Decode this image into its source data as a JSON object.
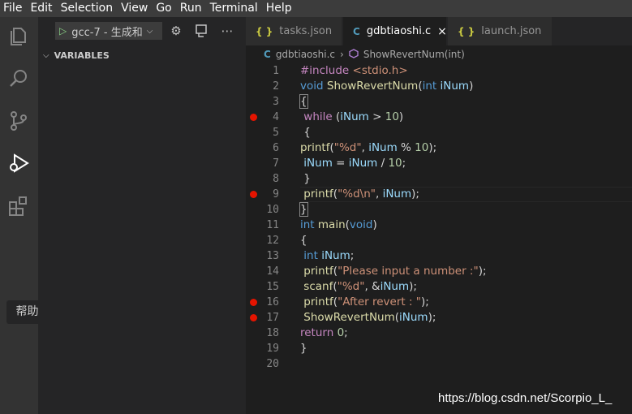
{
  "menu": [
    "File",
    "Edit",
    "Selection",
    "View",
    "Go",
    "Run",
    "Terminal",
    "Help"
  ],
  "activity_bar": {
    "icons": [
      "explorer-icon",
      "search-icon",
      "source-control-icon",
      "run-debug-icon",
      "extensions-icon"
    ],
    "tooltip": "帮助"
  },
  "debug": {
    "config": "gcc-7 - 生成和",
    "toolbar_icons": [
      "gear-icon",
      "debug-console-icon",
      "more-icon"
    ]
  },
  "sidebar": {
    "section_title": "VARIABLES"
  },
  "tabs": [
    {
      "icon": "{ }",
      "label": "tasks.json",
      "active": false
    },
    {
      "icon": "C",
      "label": "gdbtiaoshi.c",
      "active": true
    },
    {
      "icon": "{ }",
      "label": "launch.json",
      "active": false
    }
  ],
  "tab_close_glyph": "×",
  "breadcrumb": {
    "file_icon": "C",
    "file": "gdbtiaoshi.c",
    "separator": "›",
    "symbol": "ShowRevertNum(int)"
  },
  "code_lines": [
    {
      "n": "1",
      "text": "#include <stdio.h>",
      "bp": false
    },
    {
      "n": "2",
      "text": "void ShowRevertNum(int iNum)",
      "bp": false
    },
    {
      "n": "3",
      "text": "{",
      "bp": false
    },
    {
      "n": "4",
      "text": " while (iNum > 10)",
      "bp": true
    },
    {
      "n": "5",
      "text": " {",
      "bp": false
    },
    {
      "n": "6",
      "text": "printf(\"%d\", iNum % 10);",
      "bp": false
    },
    {
      "n": "7",
      "text": " iNum = iNum / 10;",
      "bp": false
    },
    {
      "n": "8",
      "text": " }",
      "bp": false
    },
    {
      "n": "9",
      "text": " printf(\"%d\\n\", iNum);",
      "bp": true
    },
    {
      "n": "10",
      "text": "}",
      "bp": false
    },
    {
      "n": "11",
      "text": "int main(void)",
      "bp": false
    },
    {
      "n": "12",
      "text": "{",
      "bp": false
    },
    {
      "n": "13",
      "text": " int iNum;",
      "bp": false
    },
    {
      "n": "14",
      "text": " printf(\"Please input a number :\");",
      "bp": false
    },
    {
      "n": "15",
      "text": " scanf(\"%d\", &iNum);",
      "bp": false
    },
    {
      "n": "16",
      "text": " printf(\"After revert : \");",
      "bp": true
    },
    {
      "n": "17",
      "text": " ShowRevertNum(iNum);",
      "bp": true
    },
    {
      "n": "18",
      "text": "return 0;",
      "bp": false
    },
    {
      "n": "19",
      "text": "}",
      "bp": false
    },
    {
      "n": "20",
      "text": "",
      "bp": false
    }
  ],
  "watermark": "https://blog.csdn.net/Scorpio_L_",
  "colors": {
    "breakpoint": "#e51400",
    "activity_bg": "#333333",
    "sidebar_bg": "#252526",
    "editor_bg": "#1e1e1e"
  }
}
